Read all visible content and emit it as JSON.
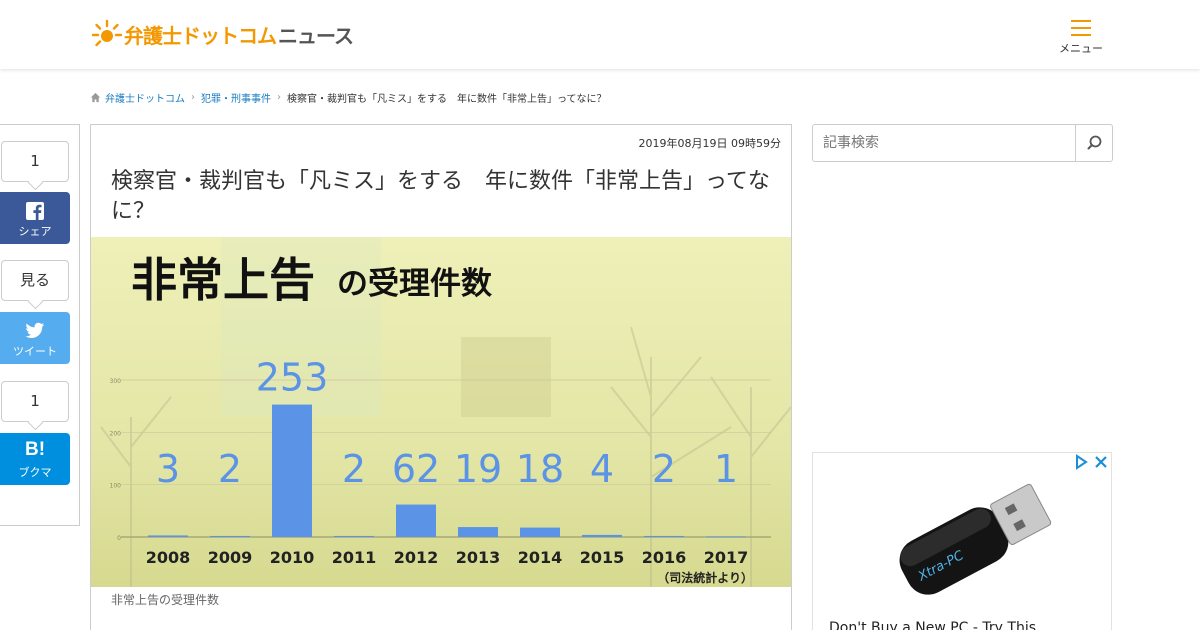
{
  "header": {
    "logo_main": "弁護士ドットコム",
    "logo_sub": "ニュース",
    "menu_label": "メニュー"
  },
  "breadcrumb": [
    "弁護士ドットコム",
    "犯罪・刑事事件",
    "検察官・裁判官も「凡ミス」をする　年に数件「非常上告」ってなに？"
  ],
  "share": {
    "facebook_count": "1",
    "facebook_label": "シェア",
    "twitter_count": "見る",
    "twitter_label": "ツイート",
    "hatena_count": "1",
    "hatena_label": "ブクマ",
    "hatena_glyph": "B!"
  },
  "article": {
    "date": "2019年08月19日 09時59分",
    "title": "検察官・裁判官も「凡ミス」をする　年に数件「非常上告」ってなに？",
    "caption": "非常上告の受理件数"
  },
  "figure": {
    "heading_big": "非常上告",
    "heading_small": "の受理件数",
    "source": "（司法統計より）"
  },
  "chart_data": {
    "type": "bar",
    "categories": [
      "2008",
      "2009",
      "2010",
      "2011",
      "2012",
      "2013",
      "2014",
      "2015",
      "2016",
      "2017"
    ],
    "values": [
      3,
      2,
      253,
      2,
      62,
      19,
      18,
      4,
      2,
      1
    ],
    "ylim": [
      0,
      300
    ],
    "yticks": [
      "0",
      "100",
      "200",
      "300"
    ],
    "bar_color": "#5b93e6",
    "label_color": "#5b93e6"
  },
  "sidebar": {
    "search_placeholder": "記事検索"
  },
  "ad": {
    "title": "Don't Buy a New PC - Try This",
    "product_text": "Xtra-PC"
  },
  "colors": {
    "brand": "#f39800",
    "link": "#1a7cc1",
    "facebook": "#3b5998",
    "twitter": "#55acee",
    "hatena": "#008fde"
  }
}
